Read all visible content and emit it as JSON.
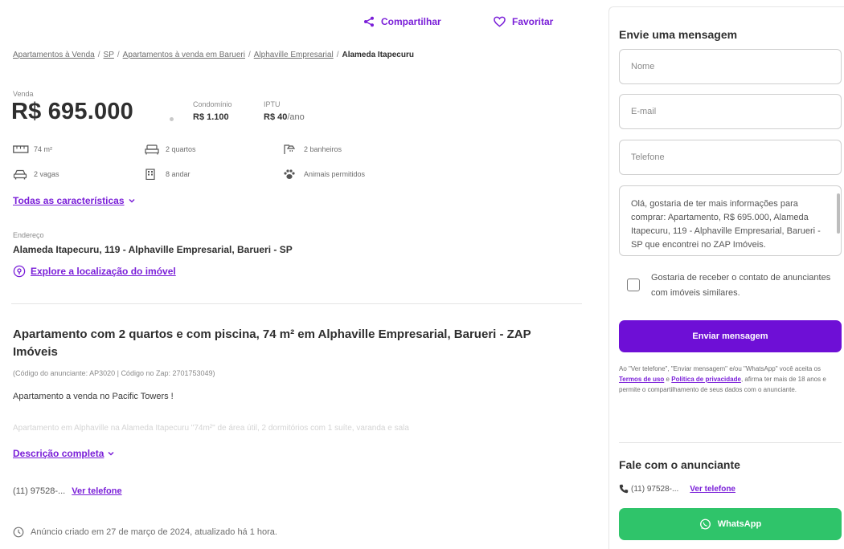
{
  "header": {
    "share_label": "Compartilhar",
    "favorite_label": "Favoritar"
  },
  "breadcrumb": {
    "items": [
      "Apartamentos à Venda",
      "SP",
      "Apartamentos à venda em Barueri",
      "Alphaville Empresarial"
    ],
    "current": "Alameda Itapecuru",
    "separator": "/"
  },
  "pricing": {
    "type_label": "Venda",
    "price": "R$ 695.000",
    "condo_label": "Condomínio",
    "condo_value": "R$ 1.100",
    "iptu_label": "IPTU",
    "iptu_value": "R$ 40",
    "iptu_unit": "/ano"
  },
  "features": {
    "area": "74 m²",
    "bedrooms": "2 quartos",
    "bathrooms": "2 banheiros",
    "parking": "2 vagas",
    "floor": "8 andar",
    "pets": "Animais permitidos",
    "all_link": "Todas as características"
  },
  "address": {
    "label": "Endereço",
    "value": "Alameda Itapecuru, 119 - Alphaville Empresarial, Barueri - SP",
    "explore_link": "Explore a localização do imóvel"
  },
  "listing": {
    "title": "Apartamento com 2 quartos e com piscina, 74 m² em Alphaville Empresarial, Barueri - ZAP Imóveis",
    "codes": "(Código do anunciante: AP3020 | Código no Zap: 2701753049)",
    "description_first": "Apartamento a venda no Pacific Towers !",
    "description_faded": "Apartamento em Alphaville na Alameda Itapecuru \"74m²\" de área útil, 2 dormitórios com 1 suíte, varanda e sala",
    "full_description_link": "Descrição completa",
    "phone_partial": "(11) 97528-...",
    "see_phone": "Ver telefone",
    "created_text": "Anúncio criado em 27 de março de 2024, atualizado há 1 hora."
  },
  "contact_form": {
    "title": "Envie uma mensagem",
    "name_placeholder": "Nome",
    "email_placeholder": "E-mail",
    "phone_placeholder": "Telefone",
    "message": "Olá, gostaria de ter mais informações para comprar: Apartamento, R$ 695.000, Alameda Itapecuru, 119 - Alphaville Empresarial, Barueri - SP que encontrei no ZAP Imóveis.",
    "similar_checkbox": "Gostaria de receber o contato de anunciantes com imóveis similares.",
    "submit": "Enviar mensagem",
    "legal_prefix": "Ao \"Ver telefone\", \"Enviar mensagem\" e/ou \"WhatsApp\" você aceita os",
    "terms": "Termos de uso",
    "legal_and": "e",
    "privacy": "Política de privacidade",
    "legal_suffix": ", afirma ter mais de 18 anos e permite o compartilhamento de seus dados com o anunciante."
  },
  "advertiser": {
    "title": "Fale com o anunciante",
    "phone_partial": "(11) 97528-...",
    "see_phone": "Ver telefone",
    "whatsapp": "WhatsApp"
  },
  "colors": {
    "brand": "#6e0fd6",
    "link": "#7a1fd8",
    "whatsapp": "#2fc46a"
  }
}
